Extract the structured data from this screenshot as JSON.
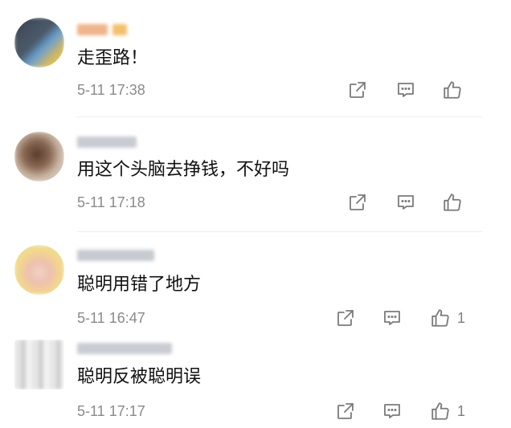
{
  "comments": [
    {
      "text": "走歪路！",
      "time": "5-11 17:38",
      "like_count": ""
    },
    {
      "text": "用这个头脑去挣钱，不好吗",
      "time": "5-11 17:18",
      "like_count": ""
    },
    {
      "text": "聪明用错了地方",
      "time": "5-11 16:47",
      "like_count": "1"
    },
    {
      "text": "聪明反被聪明误",
      "time": "5-11 17:17",
      "like_count": "1"
    }
  ],
  "icons": {
    "share": "share-icon",
    "comment": "comment-icon",
    "like": "thumbs-up-icon"
  },
  "colors": {
    "text": "#111111",
    "meta": "#8a8a8a",
    "icon": "#7a7a7a"
  }
}
